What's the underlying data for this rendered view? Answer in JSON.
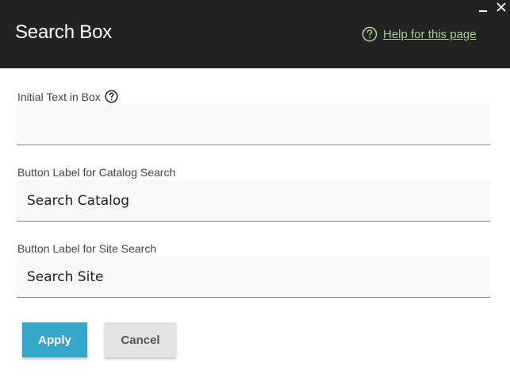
{
  "dialog": {
    "title": "Search Box",
    "help_link": "Help for this page"
  },
  "fields": [
    {
      "label": "Initial Text in Box",
      "value": "",
      "has_help_icon": true
    },
    {
      "label": "Button Label for Catalog Search",
      "value": "Search Catalog"
    },
    {
      "label": "Button Label for Site Search",
      "value": "Search Site"
    }
  ],
  "buttons": {
    "apply": "Apply",
    "cancel": "Cancel"
  },
  "colors": {
    "header_bg": "#222222",
    "help_link": "#9dd28f",
    "apply_bg": "#36a6c9",
    "cancel_bg": "#e3e3e3"
  },
  "icons": [
    "minimize-icon",
    "close-icon",
    "help-circle-icon",
    "question-circle-icon"
  ]
}
